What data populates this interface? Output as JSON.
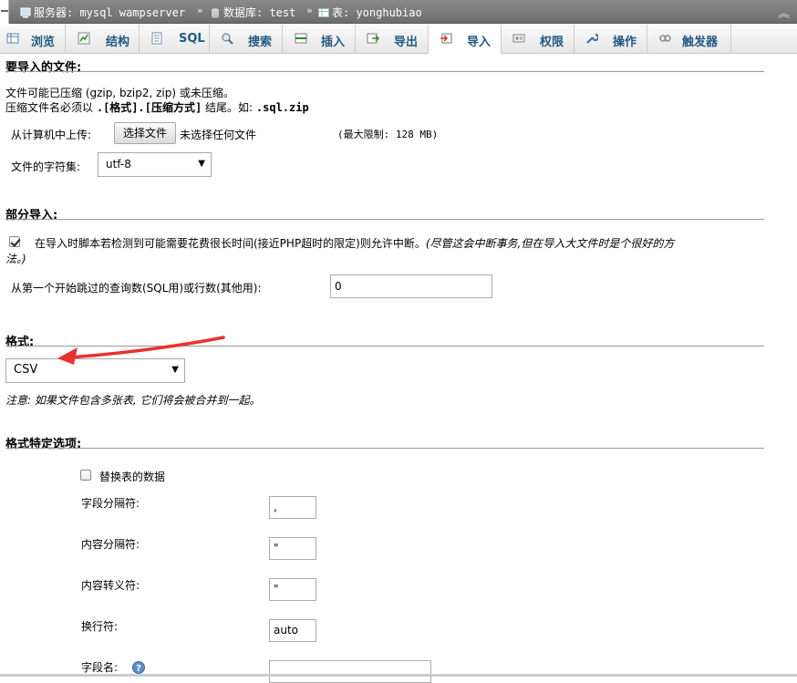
{
  "breadcrumb": {
    "server_label": "服务器: mysql wampserver",
    "database_label": "数据库: test",
    "table_label": "表: yonghubiao",
    "separator": "»",
    "collapse_icon": "double-chevron-up-icon"
  },
  "tabs": [
    {
      "label": "浏览",
      "icon": "browse-icon"
    },
    {
      "label": "结构",
      "icon": "structure-icon"
    },
    {
      "label": "SQL",
      "icon": "sql-icon"
    },
    {
      "label": "搜索",
      "icon": "search-icon"
    },
    {
      "label": "插入",
      "icon": "insert-icon"
    },
    {
      "label": "导出",
      "icon": "export-icon"
    },
    {
      "label": "导入",
      "icon": "import-icon",
      "active": true
    },
    {
      "label": "权限",
      "icon": "privileges-icon"
    },
    {
      "label": "操作",
      "icon": "wrench-icon"
    },
    {
      "label": "触发器",
      "icon": "triggers-icon"
    }
  ],
  "file_section": {
    "title": "要导入的文件:",
    "compress_note_1": "文件可能已压缩 (gzip, bzip2, zip) 或未压缩。",
    "compress_note_2a": "压缩文件名必须以",
    "compress_note_2b": ".[格式].[压缩方式]",
    "compress_note_2c": "结尾。如:",
    "compress_note_2d": ".sql.zip",
    "upload_label": "从计算机中上传:",
    "choose_file_button": "选择文件",
    "no_file_text": "未选择任何文件",
    "max_limit": "(最大限制: 128 MB)",
    "charset_label": "文件的字符集:",
    "charset_value": "utf-8"
  },
  "partial_section": {
    "title": "部分导入:",
    "allow_interrupt_checked": true,
    "allow_interrupt_text": "在导入时脚本若检测到可能需要花费很长时间(接近PHP超时的限定)则允许中断。",
    "allow_interrupt_note_1": "(尽管这会中断事务,但在导入大文件时是个很好的方",
    "allow_interrupt_note_2": "法。)",
    "skip_label": "从第一个开始跳过的查询数(SQL用)或行数(其他用):",
    "skip_value": "0"
  },
  "format_section": {
    "title": "格式:",
    "format_value": "CSV",
    "note": "注意: 如果文件包含多张表, 它们将会被合并到一起。",
    "annotation_color": "#e8322f"
  },
  "format_options": {
    "title": "格式特定选项:",
    "replace_data_checked": false,
    "replace_data_label": "替换表的数据",
    "field_separator_label": "字段分隔符:",
    "field_separator_value": ",",
    "enclosed_label": "内容分隔符:",
    "enclosed_value": "\"",
    "escaped_label": "内容转义符:",
    "escaped_value": "\"",
    "line_terminator_label": "换行符:",
    "line_terminator_value": "auto",
    "column_names_label": "字段名:",
    "column_names_value": "",
    "help_icon": "help-icon"
  }
}
